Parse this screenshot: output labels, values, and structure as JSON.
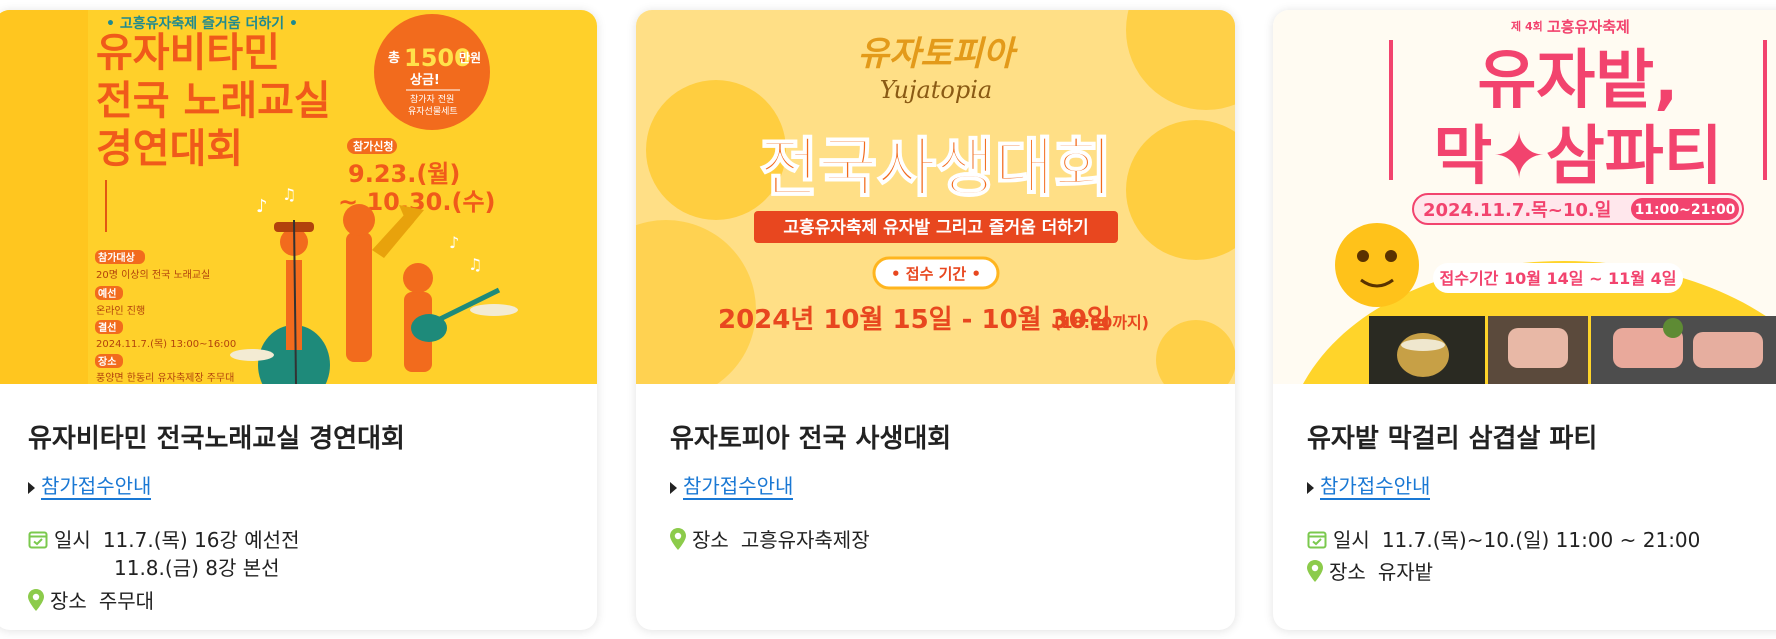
{
  "cards": [
    {
      "poster": {
        "top_banner": "• 고흥유자축제 즐거움 더하기 •",
        "headline": [
          "유자비타민",
          "전국 노래교실",
          "경연대회"
        ],
        "prize_prefix": "총",
        "prize_amount": "1500",
        "prize_unit": "만원",
        "prize_word": "상금!",
        "prize_note": [
          "참가자 전원",
          "유자선물세트"
        ],
        "apply_label": "참가신청",
        "apply_dates": [
          "9.23.(월)",
          "~ 10.30.(수)"
        ],
        "details": [
          {
            "label": "참가대상",
            "text": "20명 이상의 전국 노래교실"
          },
          {
            "label": "예선",
            "text": "온라인 진행"
          },
          {
            "label": "결선",
            "text": "2024.11.7.(목) 13:00~16:00"
          },
          {
            "label": "장소",
            "text": "풍양면 한동리 유자축제장 주무대"
          }
        ]
      },
      "title": "유자비타민 전국노래교실 경연대회",
      "link": "참가접수안내",
      "date_label": "일시",
      "date_lines": [
        "11.7.(목) 16강 예선전",
        "11.8.(금) 8강 본선"
      ],
      "place_label": "장소",
      "place_value": "주무대"
    },
    {
      "poster": {
        "logo_kr": "유자토피아",
        "logo_en": "Yujatopia",
        "headline": "전국사생대회",
        "ribbon": "고흥유자축제 유자밭 그리고 즐거움 더하기",
        "period_label": "• 접수 기간 •",
        "period": "2024년 10월 15일 - 10월 30일",
        "period_note": "(18:00까지)"
      },
      "title": "유자토피아 전국 사생대회",
      "link": "참가접수안내",
      "place_label": "장소",
      "place_value": "고흥유자축제장"
    },
    {
      "poster": {
        "edition": "제 4회",
        "festival": "고흥유자축제",
        "headline": [
          "유자밭,",
          "막✦삼파티"
        ],
        "date_pill": "2024.11.7.목~10.일",
        "time_pill": "11:00~21:00",
        "apply_pill": "접수기간 10월 14일 ~ 11월 4일"
      },
      "title": "유자밭 막걸리 삼겹살 파티",
      "link": "참가접수안내",
      "date_label": "일시",
      "date_value": "11.7.(목)~10.(일) 11:00 ~ 21:00",
      "place_label": "장소",
      "place_value": "유자밭"
    }
  ],
  "colors": {
    "yellow": "#FFD02A",
    "orange": "#F26B1D",
    "peach": "#FFDF86",
    "pink": "#F2436E",
    "link": "#1A78D4",
    "calendar_green": "#7BC94E",
    "pin_green": "#8CCB4B"
  },
  "icons": [
    "calendar-check-icon",
    "map-pin-icon",
    "caret-right-icon"
  ]
}
